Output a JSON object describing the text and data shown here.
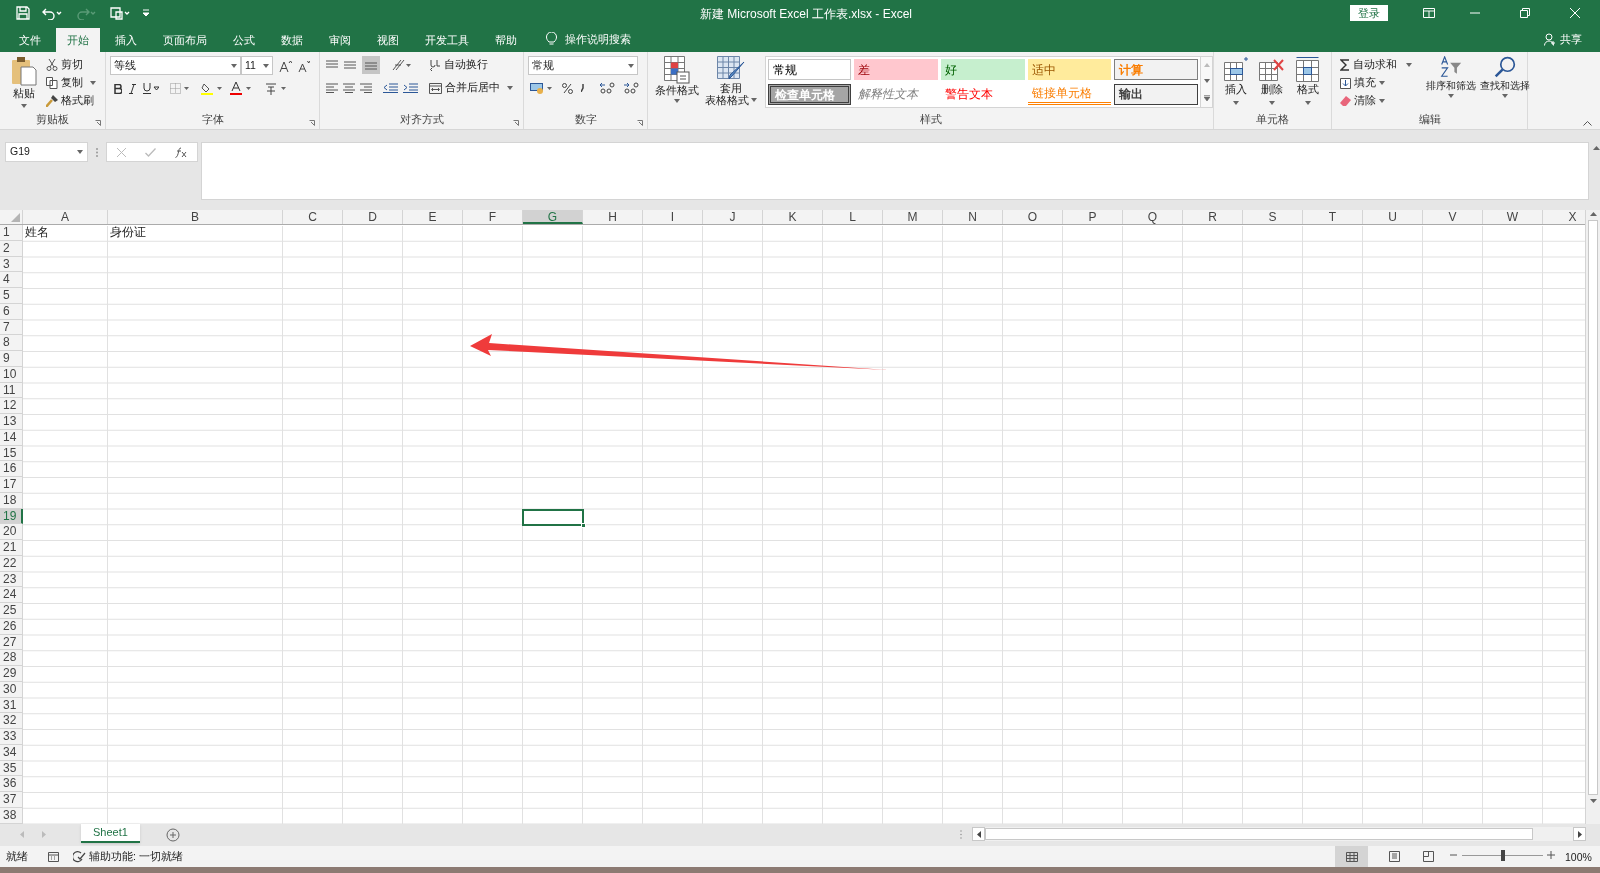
{
  "window": {
    "title": "新建 Microsoft Excel 工作表.xlsx  -  Excel",
    "login": "登录"
  },
  "tabs": [
    {
      "label": "文件",
      "selected": false
    },
    {
      "label": "开始",
      "selected": true
    },
    {
      "label": "插入",
      "selected": false
    },
    {
      "label": "页面布局",
      "selected": false
    },
    {
      "label": "公式",
      "selected": false
    },
    {
      "label": "数据",
      "selected": false
    },
    {
      "label": "审阅",
      "selected": false
    },
    {
      "label": "视图",
      "selected": false
    },
    {
      "label": "开发工具",
      "selected": false
    },
    {
      "label": "帮助",
      "selected": false
    }
  ],
  "tell_me": "操作说明搜索",
  "share": "共享",
  "ribbon": {
    "clipboard": {
      "label": "剪贴板",
      "paste": "粘贴",
      "cut": "剪切",
      "copy": "复制",
      "format_painter": "格式刷"
    },
    "font": {
      "label": "字体",
      "font_name": "等线",
      "font_size": "11"
    },
    "alignment": {
      "label": "对齐方式",
      "wrap_text": "自动换行",
      "merge_center": "合并后居中"
    },
    "number": {
      "label": "数字",
      "format": "常规"
    },
    "styles": {
      "label": "样式",
      "conditional_formatting": "条件格式",
      "format_as_table": [
        "套用",
        "表格格式"
      ],
      "cell_styles": [
        {
          "label": "常规",
          "kind": "normal"
        },
        {
          "label": "差",
          "kind": "bad"
        },
        {
          "label": "好",
          "kind": "good"
        },
        {
          "label": "适中",
          "kind": "neutral"
        },
        {
          "label": "计算",
          "kind": "calculation"
        },
        {
          "label": "检查单元格",
          "kind": "check"
        },
        {
          "label": "解释性文本",
          "kind": "explanatory"
        },
        {
          "label": "警告文本",
          "kind": "warning"
        },
        {
          "label": "链接单元格",
          "kind": "linked"
        },
        {
          "label": "输出",
          "kind": "output"
        }
      ]
    },
    "cells": {
      "label": "单元格",
      "buttons": [
        "插入",
        "删除",
        "格式"
      ]
    },
    "editing": {
      "label": "编辑",
      "autosum": "自动求和",
      "fill": "填充",
      "clear": "清除",
      "sort_filter": "排序和筛选",
      "find_select": "查找和选择"
    }
  },
  "formula_bar": {
    "name_box": "G19"
  },
  "sheet": {
    "columns": [
      {
        "label": "A",
        "selected": false
      },
      {
        "label": "B",
        "selected": false
      },
      {
        "label": "C",
        "selected": false
      },
      {
        "label": "D",
        "selected": false
      },
      {
        "label": "E",
        "selected": false
      },
      {
        "label": "F",
        "selected": false
      },
      {
        "label": "G",
        "selected": true
      },
      {
        "label": "H",
        "selected": false
      },
      {
        "label": "I",
        "selected": false
      },
      {
        "label": "J",
        "selected": false
      },
      {
        "label": "K",
        "selected": false
      },
      {
        "label": "L",
        "selected": false
      },
      {
        "label": "M",
        "selected": false
      },
      {
        "label": "N",
        "selected": false
      },
      {
        "label": "O",
        "selected": false
      },
      {
        "label": "P",
        "selected": false
      },
      {
        "label": "Q",
        "selected": false
      },
      {
        "label": "R",
        "selected": false
      },
      {
        "label": "S",
        "selected": false
      },
      {
        "label": "T",
        "selected": false
      },
      {
        "label": "U",
        "selected": false
      },
      {
        "label": "V",
        "selected": false
      },
      {
        "label": "W",
        "selected": false
      },
      {
        "label": "X",
        "selected": false
      }
    ],
    "rows": [
      {
        "label": "1",
        "selected": false,
        "cells": [
          "姓名",
          "身份证"
        ]
      },
      {
        "label": "2",
        "selected": false
      },
      {
        "label": "3",
        "selected": false
      },
      {
        "label": "4",
        "selected": false
      },
      {
        "label": "5",
        "selected": false
      },
      {
        "label": "6",
        "selected": false
      },
      {
        "label": "7",
        "selected": false
      },
      {
        "label": "8",
        "selected": false
      },
      {
        "label": "9",
        "selected": false
      },
      {
        "label": "10",
        "selected": false
      },
      {
        "label": "11",
        "selected": false
      },
      {
        "label": "12",
        "selected": false
      },
      {
        "label": "13",
        "selected": false
      },
      {
        "label": "14",
        "selected": false
      },
      {
        "label": "15",
        "selected": false
      },
      {
        "label": "16",
        "selected": false
      },
      {
        "label": "17",
        "selected": false
      },
      {
        "label": "18",
        "selected": false
      },
      {
        "label": "19",
        "selected": true
      },
      {
        "label": "20",
        "selected": false
      },
      {
        "label": "21",
        "selected": false
      },
      {
        "label": "22",
        "selected": false
      },
      {
        "label": "23",
        "selected": false
      },
      {
        "label": "24",
        "selected": false
      },
      {
        "label": "25",
        "selected": false
      },
      {
        "label": "26",
        "selected": false
      },
      {
        "label": "27",
        "selected": false
      },
      {
        "label": "28",
        "selected": false
      },
      {
        "label": "29",
        "selected": false
      },
      {
        "label": "30",
        "selected": false
      },
      {
        "label": "31",
        "selected": false
      },
      {
        "label": "32",
        "selected": false
      },
      {
        "label": "33",
        "selected": false
      },
      {
        "label": "34",
        "selected": false
      },
      {
        "label": "35",
        "selected": false
      },
      {
        "label": "36",
        "selected": false
      },
      {
        "label": "37",
        "selected": false
      },
      {
        "label": "38",
        "selected": false
      }
    ]
  },
  "sheet_tabs": [
    {
      "label": "Sheet1",
      "selected": true
    }
  ],
  "status_bar": {
    "ready": "就绪",
    "accessibility": "辅助功能: 一切就绪",
    "zoom": "100%"
  },
  "zoom_slider": {
    "level": 0.5
  }
}
